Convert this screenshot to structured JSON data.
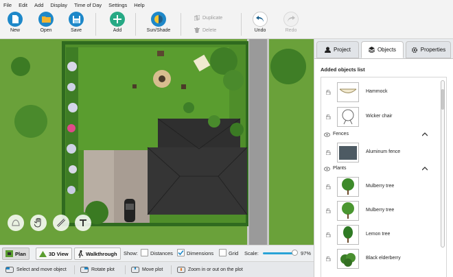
{
  "menu": [
    "File",
    "Edit",
    "Add",
    "Display",
    "Time of Day",
    "Settings",
    "Help"
  ],
  "toolbar": {
    "new": "New",
    "open": "Open",
    "save": "Save",
    "add": "Add",
    "sun_shade": "Sun/Shade",
    "duplicate": "Duplicate",
    "delete": "Delete",
    "undo": "Undo",
    "redo": "Redo"
  },
  "tabs": {
    "project": "Project",
    "objects": "Objects",
    "properties": "Properties"
  },
  "objects_panel": {
    "title": "Added objects list",
    "items": [
      {
        "type": "object",
        "label": "Hammock",
        "icon": "hammock-icon"
      },
      {
        "type": "object",
        "label": "Wicker chair",
        "icon": "wicker-chair-icon"
      },
      {
        "type": "group",
        "label": "Fences"
      },
      {
        "type": "object",
        "label": "Aluminum fence",
        "icon": "fence-icon"
      },
      {
        "type": "group",
        "label": "Plants"
      },
      {
        "type": "object",
        "label": "Mulberry tree",
        "icon": "tree-icon"
      },
      {
        "type": "object",
        "label": "Mulberry tree",
        "icon": "tree-icon"
      },
      {
        "type": "object",
        "label": "Lemon tree",
        "icon": "tree-icon"
      },
      {
        "type": "object",
        "label": "Black elderberry",
        "icon": "shrub-icon"
      }
    ]
  },
  "viewbar": {
    "plan": "Plan",
    "view3d": "3D View",
    "walkthrough": "Walkthrough",
    "show_label": "Show:",
    "distances": "Distances",
    "distances_checked": false,
    "dimensions": "Dimensions",
    "dimensions_checked": true,
    "grid": "Grid",
    "grid_checked": false,
    "scale_label": "Scale:",
    "scale_value": "97%"
  },
  "status": {
    "select": "Select and move object",
    "rotate": "Rotate plot",
    "move": "Move plot",
    "zoom": "Zoom in or out on the plot"
  },
  "colors": {
    "accent_blue": "#1e88c9",
    "add_green": "#27a985",
    "grass": "#5e9b32",
    "roof": "#2f2f2f"
  }
}
